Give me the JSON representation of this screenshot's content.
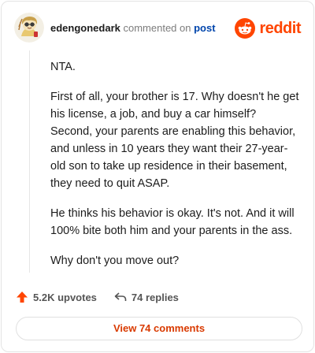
{
  "header": {
    "username": "edengonedark",
    "commented_on": "commented on",
    "post_link": "post",
    "logo_text": "reddit"
  },
  "comment": {
    "paragraphs": [
      "NTA.",
      "First of all, your brother is 17. Why doesn't he get his license, a job, and buy a car himself? Second, your parents are enabling this behavior, and unless in 10 years they want their 27-year-old son to take up residence in their basement, they need to quit ASAP.",
      "He thinks his behavior is okay. It's not. And it will 100% bite both him and your parents in the ass.",
      "Why don't you move out?"
    ]
  },
  "actions": {
    "upvotes": "5.2K upvotes",
    "replies": "74 replies"
  },
  "footer": {
    "view_comments": "View 74 comments"
  },
  "colors": {
    "brand": "#ff4500",
    "link": "#0045ac",
    "button_text": "#d93a00"
  },
  "icons": [
    "avatar",
    "reddit-logo-icon",
    "upvote-arrow-icon",
    "reply-arrow-icon"
  ]
}
